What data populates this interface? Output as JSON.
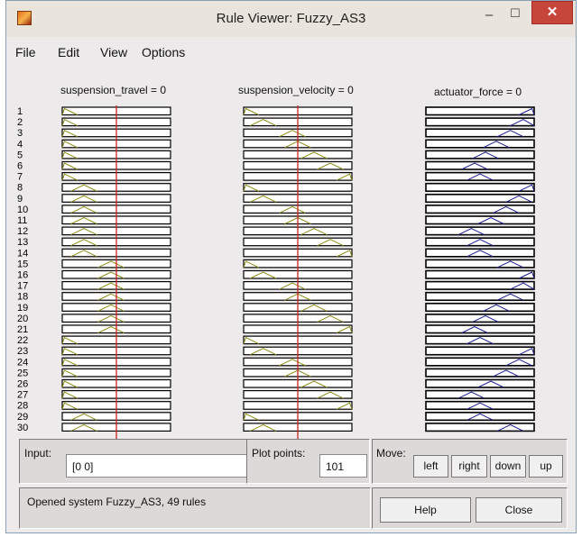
{
  "window": {
    "title": "Rule Viewer: Fuzzy_AS3",
    "min_glyph": "–",
    "max_glyph": "☐",
    "close_glyph": "✕"
  },
  "menu": [
    "File",
    "Edit",
    "View",
    "Options"
  ],
  "variables": {
    "input1": "suspension_travel = 0",
    "input2": "suspension_velocity = 0",
    "output": "actuator_force = 0"
  },
  "rules": {
    "visible_numbers": [
      "1",
      "2",
      "3",
      "4",
      "5",
      "6",
      "7",
      "8",
      "9",
      "10",
      "11",
      "12",
      "13",
      "14",
      "15",
      "16",
      "17",
      "18",
      "19",
      "20",
      "21",
      "22",
      "23",
      "24",
      "25",
      "26",
      "27",
      "28",
      "29",
      "30"
    ],
    "input_line_color": "#cc2222",
    "input_mf_color": "#8c8c18",
    "output_mf_color": "#1c1c8c"
  },
  "controls": {
    "input_label": "Input:",
    "input_value": "[0 0]",
    "plot_points_label": "Plot points:",
    "plot_points_value": "101",
    "move_label": "Move:",
    "left": "left",
    "right": "right",
    "down": "down",
    "up": "up",
    "help": "Help",
    "close": "Close"
  },
  "status": "Opened system Fuzzy_AS3, 49 rules"
}
